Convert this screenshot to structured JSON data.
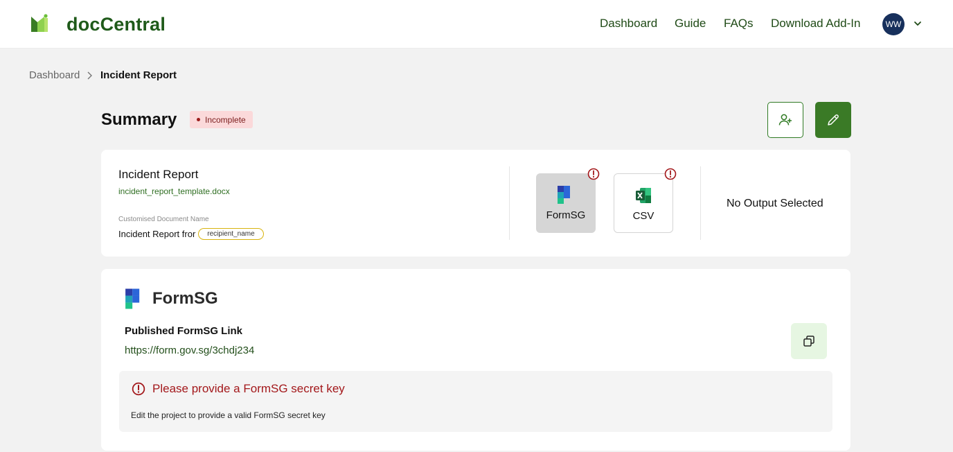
{
  "header": {
    "app_name": "docCentral",
    "nav": [
      "Dashboard",
      "Guide",
      "FAQs",
      "Download Add-In"
    ],
    "user_initials": "WW"
  },
  "breadcrumb": {
    "parent": "Dashboard",
    "current": "Incident Report"
  },
  "summary": {
    "title": "Summary",
    "status": "Incomplete"
  },
  "document": {
    "title": "Incident Report",
    "file_name": "incident_report_template.docx",
    "custom_name_label": "Customised Document Name",
    "custom_name_prefix": "Incident Report fror",
    "custom_name_field": "recipient_name"
  },
  "inputs": [
    {
      "label": "FormSG",
      "selected": true,
      "warning": true
    },
    {
      "label": "CSV",
      "selected": false,
      "warning": true
    }
  ],
  "output": {
    "text": "No Output Selected"
  },
  "formsg_section": {
    "title": "FormSG",
    "link_label": "Published FormSG Link",
    "link": "https://form.gov.sg/3chdj234",
    "alert_title": "Please provide a FormSG secret key",
    "alert_body": "Edit the project to provide a valid FormSG secret key"
  },
  "colors": {
    "brand_green": "#3a7a26",
    "error_red": "#a3181b",
    "badge_bg": "#fbd9da"
  }
}
